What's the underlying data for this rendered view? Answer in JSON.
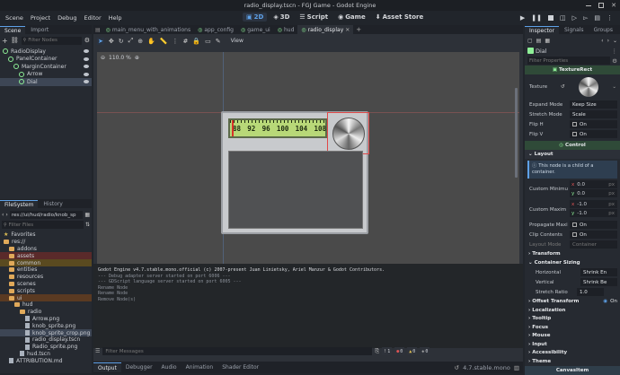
{
  "window": {
    "title": "radio_display.tscn - FGJ Game - Godot Engine"
  },
  "menu": [
    "Scene",
    "Project",
    "Debug",
    "Editor",
    "Help"
  ],
  "workspaces": [
    {
      "label": "2D",
      "icon": "2d-icon"
    },
    {
      "label": "3D",
      "icon": "3d-icon"
    },
    {
      "label": "Script",
      "icon": "script-icon"
    },
    {
      "label": "Game",
      "icon": "game-icon"
    },
    {
      "label": "Asset Store",
      "icon": "asset-store-icon"
    }
  ],
  "scene_dock": {
    "tabs": [
      "Scene",
      "Import"
    ],
    "filter_placeholder": "Filter Nodes",
    "tree": [
      {
        "label": "RadioDisplay",
        "depth": 0
      },
      {
        "label": "PanelContainer",
        "depth": 1
      },
      {
        "label": "MarginContainer",
        "depth": 2
      },
      {
        "label": "Arrow",
        "depth": 3
      },
      {
        "label": "Dial",
        "depth": 3,
        "selected": true
      }
    ]
  },
  "filesystem_dock": {
    "tabs": [
      "FileSystem",
      "History"
    ],
    "path": "res://ui/hud/radio/knob_sp",
    "filter_placeholder": "Filter Files",
    "items": [
      {
        "label": "Favorites",
        "kind": "star",
        "depth": 0
      },
      {
        "label": "res://",
        "kind": "folder",
        "depth": 0
      },
      {
        "label": "addons",
        "kind": "folder",
        "depth": 1
      },
      {
        "label": "assets",
        "kind": "folder",
        "depth": 1,
        "color": "#5a2a2a"
      },
      {
        "label": "common",
        "kind": "folder",
        "depth": 1,
        "color": "#5a4a20"
      },
      {
        "label": "entities",
        "kind": "folder",
        "depth": 1
      },
      {
        "label": "resources",
        "kind": "folder",
        "depth": 1
      },
      {
        "label": "scenes",
        "kind": "folder",
        "depth": 1
      },
      {
        "label": "scripts",
        "kind": "folder",
        "depth": 1
      },
      {
        "label": "ui",
        "kind": "folder",
        "depth": 1,
        "color": "#5a3a22"
      },
      {
        "label": "hud",
        "kind": "folder",
        "depth": 2
      },
      {
        "label": "radio",
        "kind": "folder",
        "depth": 3
      },
      {
        "label": "Arrow.png",
        "kind": "file",
        "depth": 4
      },
      {
        "label": "knob_sprite.png",
        "kind": "file",
        "depth": 4
      },
      {
        "label": "knob_sprite_crop.png",
        "kind": "file",
        "depth": 4,
        "selected": true
      },
      {
        "label": "radio_display.tscn",
        "kind": "file",
        "depth": 4
      },
      {
        "label": "Radio_sprite.png",
        "kind": "file",
        "depth": 4
      },
      {
        "label": "hud.tscn",
        "kind": "file",
        "depth": 3
      },
      {
        "label": "ATTRIBUTION.md",
        "kind": "file",
        "depth": 1
      }
    ]
  },
  "scene_tabs": [
    "main_menu_with_animations",
    "app_config",
    "game_ui",
    "hud",
    "radio_display"
  ],
  "toolbar": {
    "view_label": "View",
    "zoom": "110.0 %"
  },
  "radio": {
    "dial_numbers": [
      "88",
      "92",
      "96",
      "100",
      "104",
      "108"
    ]
  },
  "output": {
    "lines": [
      "Godot Engine v4.7.stable.mono.official (c) 2007-present Juan Linietsky, Ariel Manzur & Godot Contributors.",
      "--- Debug adapter server started on port 6006 ---",
      "--- GDScript language server started on port 6005 ---",
      "Rename Node",
      "Rename Node",
      "Remove Node(s)"
    ],
    "filter_placeholder": "Filter Messages",
    "counts": [
      "1",
      "0",
      "0",
      "0"
    ]
  },
  "bottom_tabs": [
    "Output",
    "Debugger",
    "Audio",
    "Animation",
    "Shader Editor"
  ],
  "version": "4.7.stable.mono",
  "inspector": {
    "tabs": [
      "Inspector",
      "Signals",
      "Groups"
    ],
    "node_name": "Dial",
    "filter_placeholder": "Filter Properties",
    "class_header": "TextureRect",
    "props": [
      {
        "label": "Texture",
        "value": ""
      },
      {
        "label": "Expand Mode",
        "value": "Keep Size"
      },
      {
        "label": "Stretch Mode",
        "value": "Scale"
      },
      {
        "label": "Flip H",
        "value": "On"
      },
      {
        "label": "Flip V",
        "value": "On"
      }
    ],
    "control_header": "Control",
    "layout_label": "Layout",
    "layout_note": "This node is a child of a container.",
    "min_label": "Custom Minimu",
    "min_x": "0.0",
    "min_y": "0.0",
    "max_label": "Custom Maxim",
    "max_x": "-1.0",
    "max_y": "-1.0",
    "unit": "px",
    "propagate_label": "Propagate Maxi",
    "clip_label": "Clip Contents",
    "on": "On",
    "layout_mode_label": "Layout Mode",
    "layout_mode_value": "Container",
    "transform_label": "Transform",
    "sizing_label": "Container Sizing",
    "horizontal_label": "Horizontal",
    "horizontal_value": "Shrink En",
    "vertical_label": "Vertical",
    "vertical_value": "Shrink Be",
    "stretch_label": "Stretch Ratio",
    "stretch_value": "1.0",
    "offset_label": "Offset Transform",
    "sections": [
      "Localization",
      "Tooltip",
      "Focus",
      "Mouse",
      "Input",
      "Accessibility",
      "Theme"
    ],
    "footer": "CanvasItem"
  },
  "colors": {
    "accent": "#5ea1e8",
    "node_green": "#8eef97",
    "dial_green": "#b8d878"
  }
}
